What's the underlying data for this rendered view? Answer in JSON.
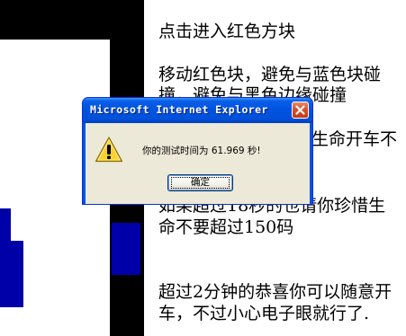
{
  "dialog": {
    "title": "Microsoft Internet Explorer",
    "message": "你的测试时间为 61.969 秒!",
    "ok_label": "确定",
    "icon": "warning-icon",
    "close_icon": "close-icon"
  },
  "instructions": {
    "line1": "点击进入红色方块",
    "line2": "移动红色块，避免与蓝色块碰",
    "line3": "撞，避免与黑色边缘碰撞",
    "line4": "生命开车不",
    "line5": "如果超过18秒的也请你珍惜生",
    "line6": "命不要超过150码",
    "line7": "超过2分钟的恭喜你可以随意开",
    "line8": "车，不过小心电子眼就行了."
  },
  "colors": {
    "game_border": "#000000",
    "blue_block": "#0000a8",
    "xp_title_blue": "#0053e1",
    "dialog_face": "#ece9d8"
  }
}
